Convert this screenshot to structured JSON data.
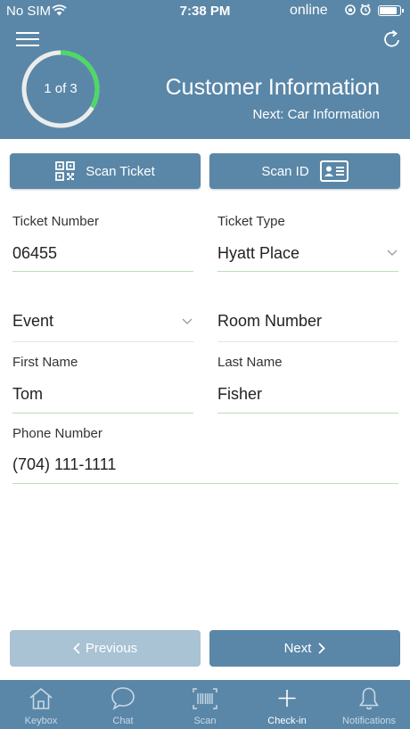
{
  "status_bar": {
    "carrier": "No SIM",
    "time": "7:38 PM",
    "connection": "online",
    "battery_level": 0.9
  },
  "header": {
    "progress": {
      "label": "1 of 3",
      "current": 1,
      "total": 3
    },
    "title": "Customer Information",
    "next_step": "Next: Car Information"
  },
  "scan_buttons": {
    "ticket_label": "Scan Ticket",
    "id_label": "Scan ID"
  },
  "form": {
    "ticket_number": {
      "label": "Ticket Number",
      "value": "06455"
    },
    "ticket_type": {
      "label": "Ticket Type",
      "value": "Hyatt Place"
    },
    "event": {
      "value": "Event"
    },
    "room_number": {
      "placeholder": "Room Number"
    },
    "first_name": {
      "label": "First Name",
      "value": "Tom"
    },
    "last_name": {
      "label": "Last Name",
      "value": "Fisher"
    },
    "phone_number": {
      "label": "Phone Number",
      "value": "(704) 111-1111"
    }
  },
  "navigation": {
    "previous_label": "Previous",
    "next_label": "Next"
  },
  "tab_bar": {
    "items": [
      {
        "label": "Keybox",
        "icon": "house-icon"
      },
      {
        "label": "Chat",
        "icon": "chat-bubble-icon"
      },
      {
        "label": "Scan",
        "icon": "barcode-icon"
      },
      {
        "label": "Check-in",
        "icon": "plus-icon"
      },
      {
        "label": "Notifications",
        "icon": "bell-icon"
      }
    ],
    "active": "Check-in"
  },
  "colors": {
    "primary": "#5a87a8",
    "primary_disabled": "#a9c2d4",
    "progress_accent": "#4cd964",
    "field_underline": "#b7dfb9"
  }
}
